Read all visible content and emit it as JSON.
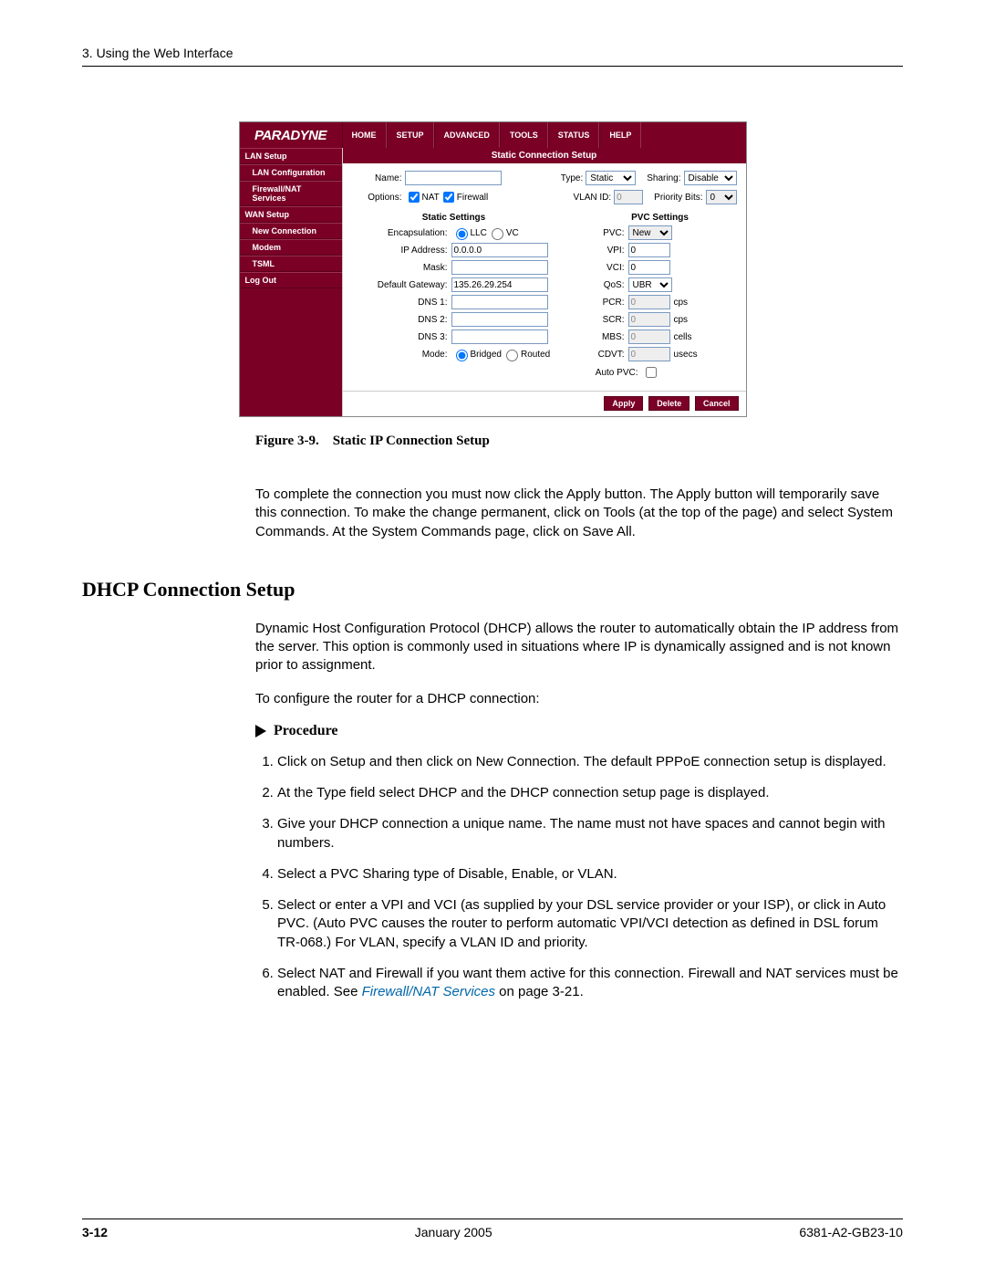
{
  "header": {
    "chapter": "3. Using the Web Interface"
  },
  "screenshot": {
    "logo": "PARADYNE",
    "nav": [
      "HOME",
      "SETUP",
      "ADVANCED",
      "TOOLS",
      "STATUS",
      "HELP"
    ],
    "sidebar": {
      "groups": [
        {
          "head": "LAN Setup",
          "items": [
            "LAN Configuration",
            "Firewall/NAT Services"
          ]
        },
        {
          "head": "WAN Setup",
          "items": [
            "New Connection",
            "Modem",
            "TSML"
          ]
        },
        {
          "head": "Log Out",
          "items": []
        }
      ]
    },
    "panel_title": "Static Connection Setup",
    "row1": {
      "name_lbl": "Name:",
      "name_val": "",
      "type_lbl": "Type:",
      "type_val": "Static",
      "sharing_lbl": "Sharing:",
      "sharing_val": "Disable"
    },
    "row2": {
      "options_lbl": "Options:",
      "nat_lbl": "NAT",
      "fw_lbl": "Firewall",
      "vlan_lbl": "VLAN ID:",
      "vlan_val": "0",
      "pri_lbl": "Priority Bits:",
      "pri_val": "0"
    },
    "static": {
      "title": "Static Settings",
      "encap_lbl": "Encapsulation:",
      "encap_llc": "LLC",
      "encap_vc": "VC",
      "ip_lbl": "IP Address:",
      "ip_val": "0.0.0.0",
      "mask_lbl": "Mask:",
      "mask_val": "",
      "gw_lbl": "Default Gateway:",
      "gw_val": "135.26.29.254",
      "dns1_lbl": "DNS 1:",
      "dns2_lbl": "DNS 2:",
      "dns3_lbl": "DNS 3:",
      "mode_lbl": "Mode:",
      "mode_bridged": "Bridged",
      "mode_routed": "Routed"
    },
    "pvc": {
      "title": "PVC Settings",
      "pvc_lbl": "PVC:",
      "pvc_val": "New",
      "vpi_lbl": "VPI:",
      "vpi_val": "0",
      "vci_lbl": "VCI:",
      "vci_val": "0",
      "qos_lbl": "QoS:",
      "qos_val": "UBR",
      "pcr_lbl": "PCR:",
      "pcr_val": "0",
      "pcr_unit": "cps",
      "scr_lbl": "SCR:",
      "scr_val": "0",
      "scr_unit": "cps",
      "mbs_lbl": "MBS:",
      "mbs_val": "0",
      "mbs_unit": "cells",
      "cdvt_lbl": "CDVT:",
      "cdvt_val": "0",
      "cdvt_unit": "usecs",
      "auto_lbl": "Auto PVC:"
    },
    "buttons": {
      "apply": "Apply",
      "delete": "Delete",
      "cancel": "Cancel"
    }
  },
  "figure_caption": "Figure 3-9. Static IP Connection Setup",
  "para1": "To complete the connection you must now click the Apply button. The Apply button will temporarily save this connection. To make the change permanent, click on Tools (at the top of the page) and select System Commands. At the System Commands page, click on Save All.",
  "section_heading": "DHCP Connection Setup",
  "para2": "Dynamic Host Configuration Protocol (DHCP) allows the router to automatically obtain the IP address from the server. This option is commonly used in situations where IP is dynamically assigned and is not known prior to assignment.",
  "para3": "To configure the router for a DHCP connection:",
  "procedure_lbl": "Procedure",
  "steps": [
    "Click on Setup and then click on New Connection. The default PPPoE connection setup is displayed.",
    "At the Type field select DHCP and the DHCP connection setup page is displayed.",
    "Give your DHCP connection a unique name. The name must not have spaces and cannot begin with numbers.",
    "Select a PVC Sharing type of Disable, Enable, or VLAN.",
    "Select or enter a VPI and VCI (as supplied by your DSL service provider or your ISP), or click in Auto PVC. (Auto PVC causes the router to perform automatic VPI/VCI detection as defined in DSL forum TR-068.) For VLAN, specify a VLAN ID and priority.",
    "Select NAT and Firewall if you want them active for this connection. Firewall and NAT services must be enabled. See "
  ],
  "step6_link": "Firewall/NAT Services",
  "step6_tail": " on page 3-21.",
  "footer": {
    "page": "3-12",
    "date": "January 2005",
    "doc": "6381-A2-GB23-10"
  }
}
